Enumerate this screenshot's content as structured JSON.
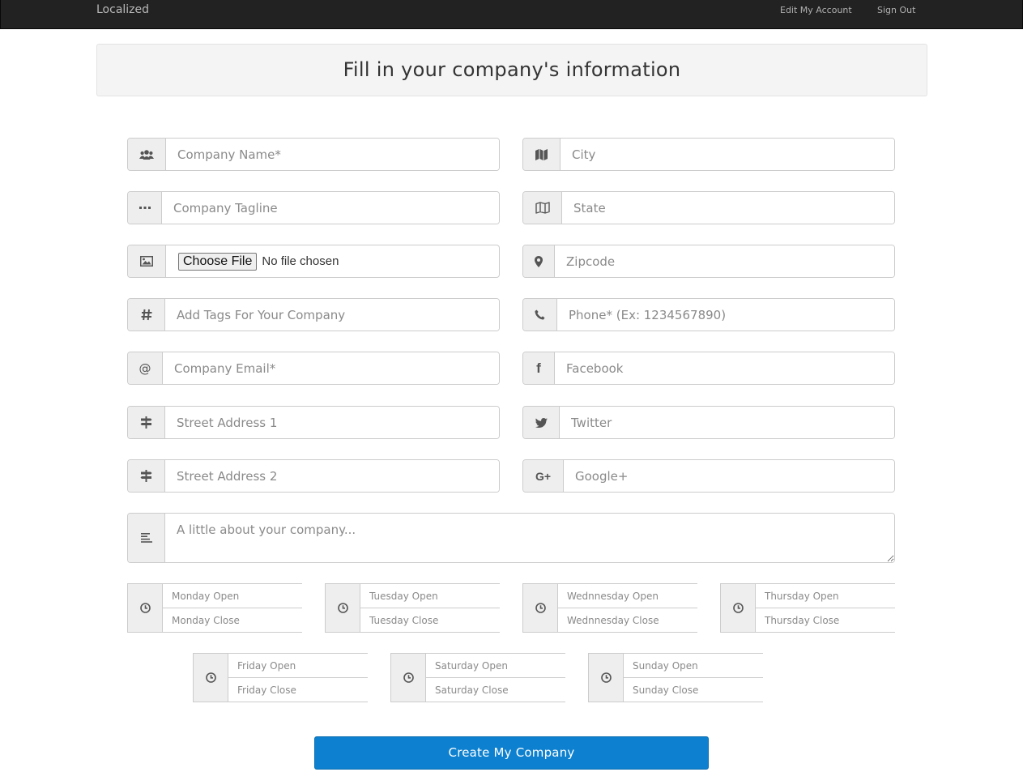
{
  "navbar": {
    "brand": "Localized",
    "edit_account": "Edit My Account",
    "sign_out": "Sign Out"
  },
  "header": {
    "title": "Fill in your company's information"
  },
  "left_fields": {
    "company_name": {
      "placeholder": "Company Name*",
      "icon": "users-icon"
    },
    "tagline": {
      "placeholder": "Company Tagline",
      "icon": "ellipsis-icon"
    },
    "logo": {
      "button": "Choose File",
      "status": "No file chosen",
      "icon": "image-icon"
    },
    "tags": {
      "placeholder": "Add Tags For Your Company",
      "icon": "hashtag-icon"
    },
    "email": {
      "placeholder": "Company Email*",
      "icon": "at-icon"
    },
    "street1": {
      "placeholder": "Street Address 1",
      "icon": "signpost-icon"
    },
    "street2": {
      "placeholder": "Street Address 2",
      "icon": "signpost-icon"
    }
  },
  "right_fields": {
    "city": {
      "placeholder": "City",
      "icon": "map-icon"
    },
    "state": {
      "placeholder": "State",
      "icon": "map-outline-icon"
    },
    "zipcode": {
      "placeholder": "Zipcode",
      "icon": "map-marker-icon"
    },
    "phone": {
      "placeholder": "Phone* (Ex: 1234567890)",
      "icon": "phone-icon"
    },
    "facebook": {
      "placeholder": "Facebook",
      "icon": "facebook-icon"
    },
    "twitter": {
      "placeholder": "Twitter",
      "icon": "twitter-icon"
    },
    "google": {
      "placeholder": "Google+",
      "icon": "google-plus-icon"
    }
  },
  "about": {
    "placeholder": "A little about your company...",
    "icon": "align-left-icon"
  },
  "hours": {
    "monday": {
      "open": "Monday Open",
      "close": "Monday Close"
    },
    "tuesday": {
      "open": "Tuesday Open",
      "close": "Tuesday Close"
    },
    "wednesday": {
      "open": "Wednnesday Open",
      "close": "Wednnesday Close"
    },
    "thursday": {
      "open": "Thursday Open",
      "close": "Thursday Close"
    },
    "friday": {
      "open": "Friday Open",
      "close": "Friday Close"
    },
    "saturday": {
      "open": "Saturday Open",
      "close": "Saturday Close"
    },
    "sunday": {
      "open": "Sunday Open",
      "close": "Sunday Close"
    }
  },
  "submit": {
    "label": "Create My Company"
  },
  "colors": {
    "navbar_bg": "#222222",
    "primary_button": "#0d80cf",
    "addon_bg": "#eeeeee",
    "header_bg": "#f4f4f4"
  }
}
